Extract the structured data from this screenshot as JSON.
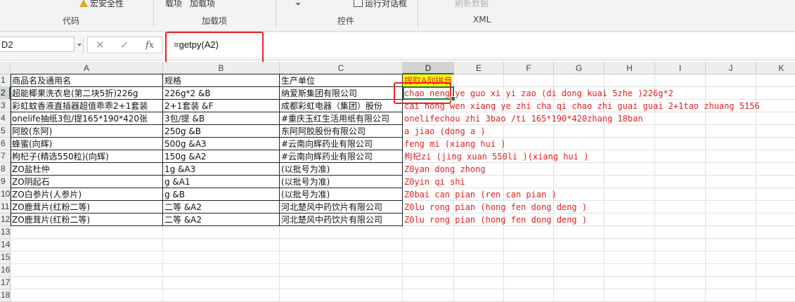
{
  "ribbon": {
    "macro_security_label": "宏安全性",
    "addins_label": "载项",
    "com_addins_label": "加载项",
    "run_dialog_label": "运行对话框",
    "refresh_data_label": "刷新数据",
    "groups": {
      "code": "代码",
      "addins": "加载项",
      "controls": "控件",
      "xml": "XML"
    }
  },
  "formula_bar": {
    "name_box": "D2",
    "cancel_glyph": "✕",
    "confirm_glyph": "✓",
    "fx_label": "fx",
    "formula": "=getpy(A2)"
  },
  "columns": [
    "A",
    "B",
    "C",
    "D",
    "E",
    "F",
    "G",
    "H",
    "I",
    "J",
    "K"
  ],
  "rows": [
    "1",
    "2",
    "3",
    "4",
    "5",
    "6",
    "7",
    "8",
    "9",
    "10",
    "11",
    "12",
    "13",
    "14",
    "15",
    "16",
    "17",
    "18"
  ],
  "header_row": {
    "A": "商品名及通用名",
    "B": "规格",
    "C": "生产单位",
    "D": "提取A列拼音"
  },
  "table": [
    {
      "A": "超能椰果洗衣皂(第二块5折)226g",
      "B": "226g*2  &B",
      "C": "纳爱斯集团有限公司",
      "D": "chao neng ye guo xi yi zao (di dong kuai 5zhe )226g*2"
    },
    {
      "A": "彩虹蚊香液直插器超值乖乖2+1套装",
      "B": "2+1套装  &F",
      "C": "成都彩虹电器（集团）股份",
      "D": "cai hong wen xiang ye zhi cha qi chao zhi guai guai 2+1tao zhuang 5156"
    },
    {
      "A": "onelife抽纸3包/提165*190*420张",
      "B": "3包/提  &B",
      "C": "#重庆玉红生活用纸有限公司",
      "D": "onelifechou zhi 3bao /ti 165*190*420zhang 18ban"
    },
    {
      "A": "阿胶(东阿)",
      "B": "250g  &B",
      "C": "东阿阿胶股份有限公司",
      "D": "a jiao (dong a )"
    },
    {
      "A": "蜂蜜(向辉)",
      "B": "500g  &A3",
      "C": "#云南向辉药业有限公司",
      "D": "feng mi (xiang hui )"
    },
    {
      "A": "枸杞子(精选550粒)(向辉)",
      "B": "150g  &A2",
      "C": "#云南向辉药业有限公司",
      "D": "枸杞zi (jing xuan 550li )(xiang hui )"
    },
    {
      "A": "ZO盐杜仲",
      "B": "1g  &A3",
      "C": "(以批号为准)",
      "D": "Z0yan dong zhong"
    },
    {
      "A": "ZO阴起石",
      "B": "g  &A1",
      "C": "(以批号为准)",
      "D": "Z0yin qi shi"
    },
    {
      "A": "ZO白参片(人参片)",
      "B": "g  &B",
      "C": "(以批号为准)",
      "D": "Z0bai can pian (ren can pian )"
    },
    {
      "A": "ZO鹿茸片(红粉二等)",
      "B": "二等  &A2",
      "C": "河北楚风中药饮片有限公司",
      "D": "Z0lu rong pian (hong fen dong deng )"
    },
    {
      "A": "ZO鹿茸片(红粉二等)",
      "B": "二等  &A2",
      "C": "河北楚风中药饮片有限公司",
      "D": "Z0lu rong pian (hong fen dong deng )"
    }
  ],
  "colors": {
    "accent_green": "#217346",
    "highlight_red": "#e8242a",
    "pinyin_red": "#e02020",
    "header_fill_yellow": "#ffff00"
  }
}
